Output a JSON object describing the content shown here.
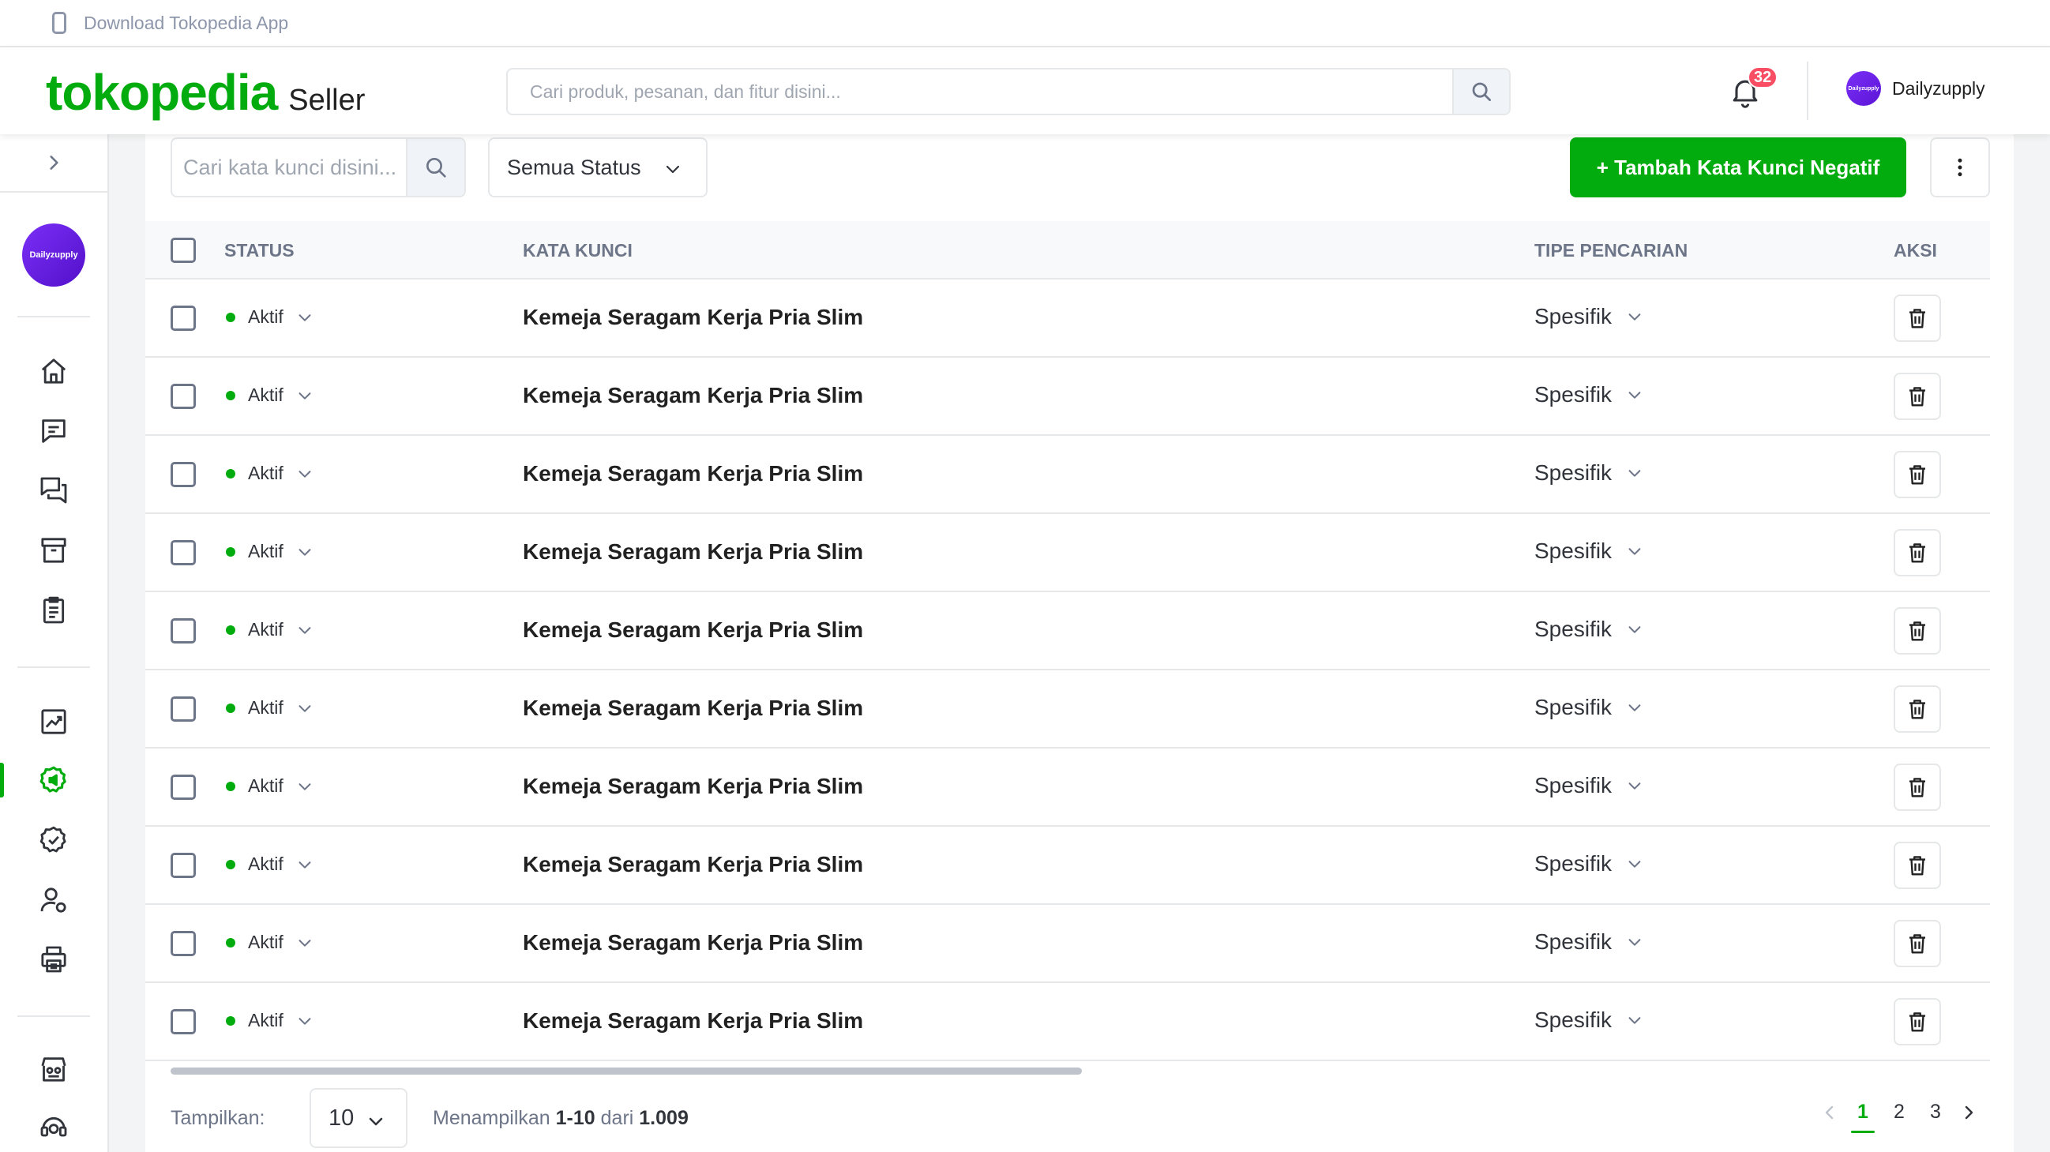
{
  "topbar": {
    "download_text": "Download Tokopedia App"
  },
  "header": {
    "brand": "tokopedia",
    "brand_suffix": "Seller",
    "search_placeholder": "Cari produk, pesanan, dan fitur disini...",
    "notification_count": "32",
    "user_name": "Dailyzupply",
    "avatar_text": "Dailyzupply"
  },
  "sidebar": {
    "shop_avatar_text": "Dailyzupply",
    "icons": [
      "home-icon",
      "chat-icon",
      "discussion-icon",
      "product-icon",
      "order-icon",
      "statistics-icon",
      "ads-icon",
      "badge-icon",
      "user-settings-icon",
      "print-icon",
      "shop-service-icon",
      "help-icon"
    ],
    "active_item": "ads-icon"
  },
  "toolbar": {
    "search_placeholder": "Cari kata kunci disini...",
    "status_filter": "Semua Status",
    "add_button": "+ Tambah Kata Kunci Negatif"
  },
  "table": {
    "headers": {
      "status": "STATUS",
      "keyword": "KATA KUNCI",
      "search_type": "TIPE PENCARIAN",
      "action": "AKSI"
    },
    "rows": [
      {
        "status": "Aktif",
        "keyword": "Kemeja Seragam Kerja Pria Slim",
        "type": "Spesifik"
      },
      {
        "status": "Aktif",
        "keyword": "Kemeja Seragam Kerja Pria Slim",
        "type": "Spesifik"
      },
      {
        "status": "Aktif",
        "keyword": "Kemeja Seragam Kerja Pria Slim",
        "type": "Spesifik"
      },
      {
        "status": "Aktif",
        "keyword": "Kemeja Seragam Kerja Pria Slim",
        "type": "Spesifik"
      },
      {
        "status": "Aktif",
        "keyword": "Kemeja Seragam Kerja Pria Slim",
        "type": "Spesifik"
      },
      {
        "status": "Aktif",
        "keyword": "Kemeja Seragam Kerja Pria Slim",
        "type": "Spesifik"
      },
      {
        "status": "Aktif",
        "keyword": "Kemeja Seragam Kerja Pria Slim",
        "type": "Spesifik"
      },
      {
        "status": "Aktif",
        "keyword": "Kemeja Seragam Kerja Pria Slim",
        "type": "Spesifik"
      },
      {
        "status": "Aktif",
        "keyword": "Kemeja Seragam Kerja Pria Slim",
        "type": "Spesifik"
      },
      {
        "status": "Aktif",
        "keyword": "Kemeja Seragam Kerja Pria Slim",
        "type": "Spesifik"
      }
    ]
  },
  "footer": {
    "show_label": "Tampilkan:",
    "page_size": "10",
    "info_prefix": "Menampilkan",
    "info_range": "1-10",
    "info_mid": "dari",
    "info_total": "1.009",
    "pages": [
      "1",
      "2",
      "3"
    ],
    "current_page": "1"
  },
  "colors": {
    "accent": "#03ac0e",
    "badge": "#f94d63",
    "border": "#e5e7e9",
    "avatar": "#6a1fe8"
  }
}
